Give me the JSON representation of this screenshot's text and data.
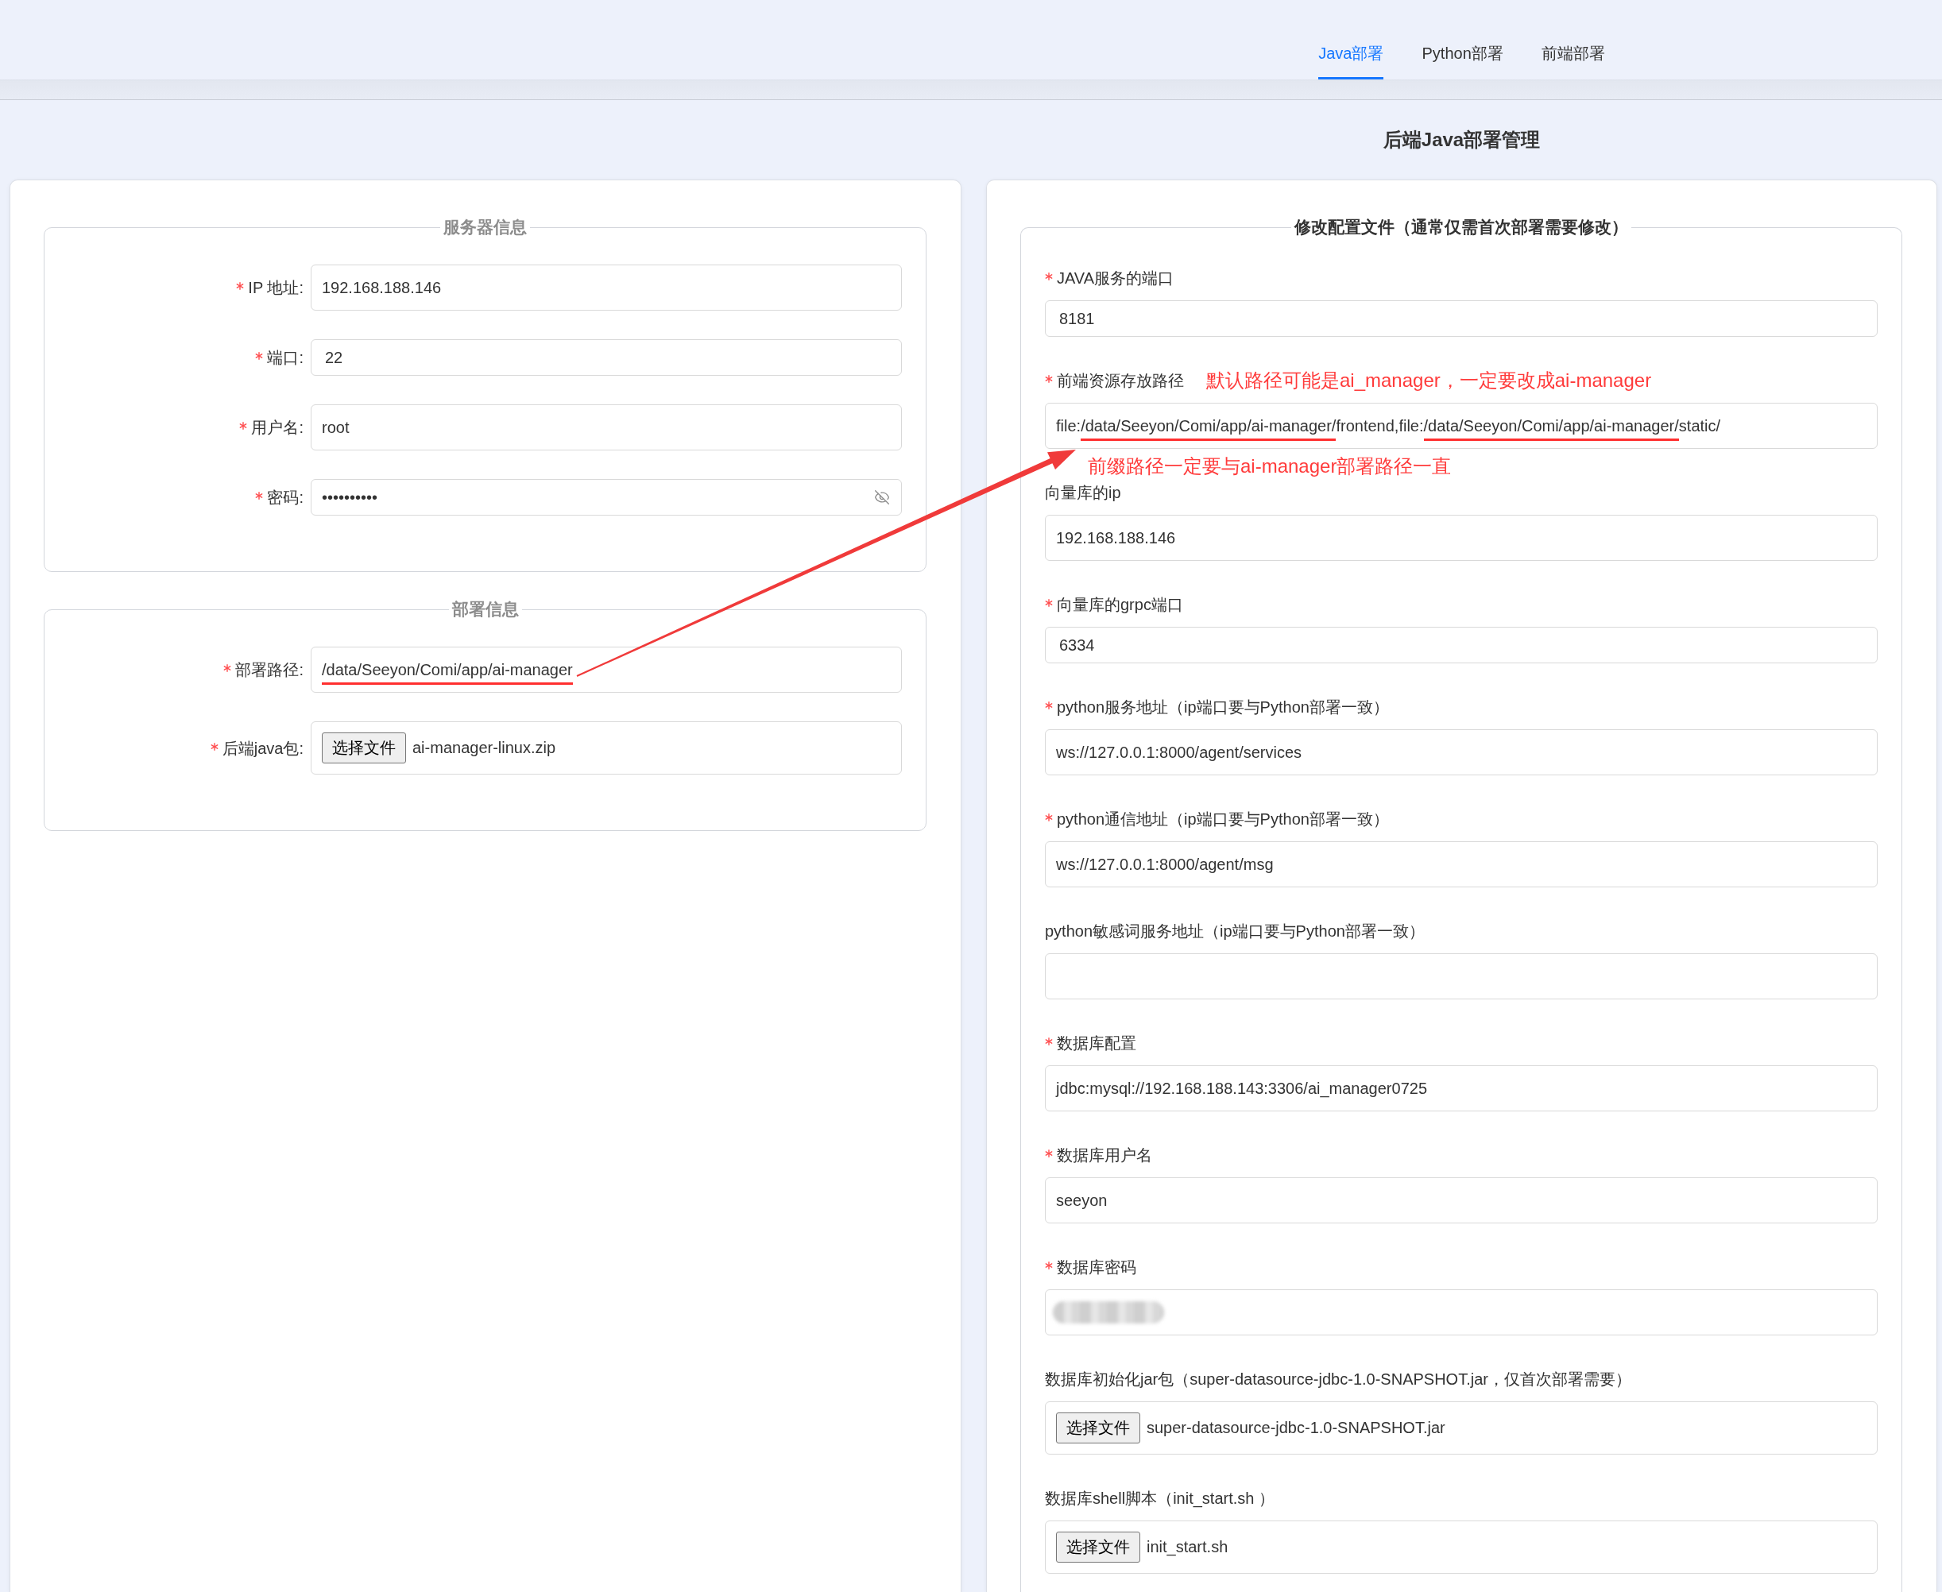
{
  "tabs": [
    {
      "label": "Java部署",
      "selected": true
    },
    {
      "label": "Python部署",
      "selected": false
    },
    {
      "label": "前端部署",
      "selected": false
    }
  ],
  "page_title": "后端Java部署管理",
  "left_panel": {
    "sections": [
      {
        "legend": "服务器信息",
        "fields": [
          {
            "label": "IP 地址:",
            "required": true,
            "kind": "text",
            "value": "192.168.188.146"
          },
          {
            "label": "端口:",
            "required": true,
            "kind": "number",
            "value": "22"
          },
          {
            "label": "用户名:",
            "required": true,
            "kind": "text",
            "value": "root"
          },
          {
            "label": "密码:",
            "required": true,
            "kind": "password",
            "value": "••••••••••"
          }
        ]
      },
      {
        "legend": "部署信息",
        "fields": [
          {
            "label": "部署路径:",
            "required": true,
            "kind": "text",
            "value_parts": [
              {
                "text": "/data/Seeyon/Comi/app/ai-manager",
                "underlined": true
              }
            ]
          },
          {
            "label": "后端java包:",
            "required": true,
            "kind": "file",
            "button": "选择文件",
            "value": "ai-manager-linux.zip"
          }
        ]
      }
    ]
  },
  "right_panel": {
    "legend": "修改配置文件（通常仅需首次部署需要修改）",
    "fields": [
      {
        "label": "JAVA服务的端口",
        "required": true,
        "kind": "number",
        "value": "8181"
      },
      {
        "label": "前端资源存放路径",
        "required": true,
        "kind": "text",
        "label_note": "默认路径可能是ai_manager，一定要改成ai-manager",
        "value_parts": [
          {
            "text": "file:",
            "underlined": false
          },
          {
            "text": "/data/Seeyon/Comi/app/ai-manager/",
            "underlined": true
          },
          {
            "text": "frontend,file:",
            "underlined": false
          },
          {
            "text": "/data/Seeyon/Comi/app/ai-manager/",
            "underlined": true
          },
          {
            "text": "static/",
            "underlined": false
          }
        ],
        "field_note": "前缀路径一定要与ai-manager部署路径一直"
      },
      {
        "label": "向量库的ip",
        "required": false,
        "kind": "text",
        "value": "192.168.188.146"
      },
      {
        "label": "向量库的grpc端口",
        "required": true,
        "kind": "number",
        "value": "6334"
      },
      {
        "label": "python服务地址（ip端口要与Python部署一致）",
        "required": true,
        "kind": "text",
        "value": "ws://127.0.0.1:8000/agent/services"
      },
      {
        "label": "python通信地址（ip端口要与Python部署一致）",
        "required": true,
        "kind": "text",
        "value": "ws://127.0.0.1:8000/agent/msg"
      },
      {
        "label": "python敏感词服务地址（ip端口要与Python部署一致）",
        "required": false,
        "kind": "text"
      },
      {
        "label": "数据库配置",
        "required": true,
        "kind": "text",
        "value": "jdbc:mysql://192.168.188.143:3306/ai_manager0725"
      },
      {
        "label": "数据库用户名",
        "required": true,
        "kind": "text",
        "value": "seeyon"
      },
      {
        "label": "数据库密码",
        "required": true,
        "kind": "redacted"
      },
      {
        "label": "数据库初始化jar包（super-datasource-jdbc-1.0-SNAPSHOT.jar，仅首次部署需要）",
        "required": false,
        "kind": "file",
        "button": "选择文件",
        "value": "super-datasource-jdbc-1.0-SNAPSHOT.jar"
      },
      {
        "label": "数据库shell脚本（init_start.sh ）",
        "required": false,
        "kind": "file",
        "button": "选择文件",
        "value": "init_start.sh"
      }
    ]
  }
}
